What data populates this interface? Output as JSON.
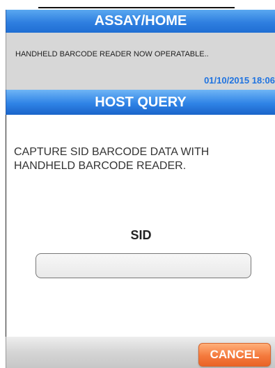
{
  "window": {
    "title": "ASSAY/HOME"
  },
  "status": {
    "message": "HANDHELD BARCODE READER NOW OPERATABLE..",
    "datetime": "01/10/2015 18:06"
  },
  "panel": {
    "header": "HOST QUERY",
    "instruction": "CAPTURE SID BARCODE DATA WITH HANDHELD BARCODE READER.",
    "sid_label": "SID",
    "sid_value": ""
  },
  "footer": {
    "cancel_label": "CANCEL"
  },
  "colors": {
    "title_bar": "#2f7fe0",
    "message_bg": "#d7d7d7",
    "datetime": "#1f73e0",
    "cancel_button": "#f47a3d"
  }
}
